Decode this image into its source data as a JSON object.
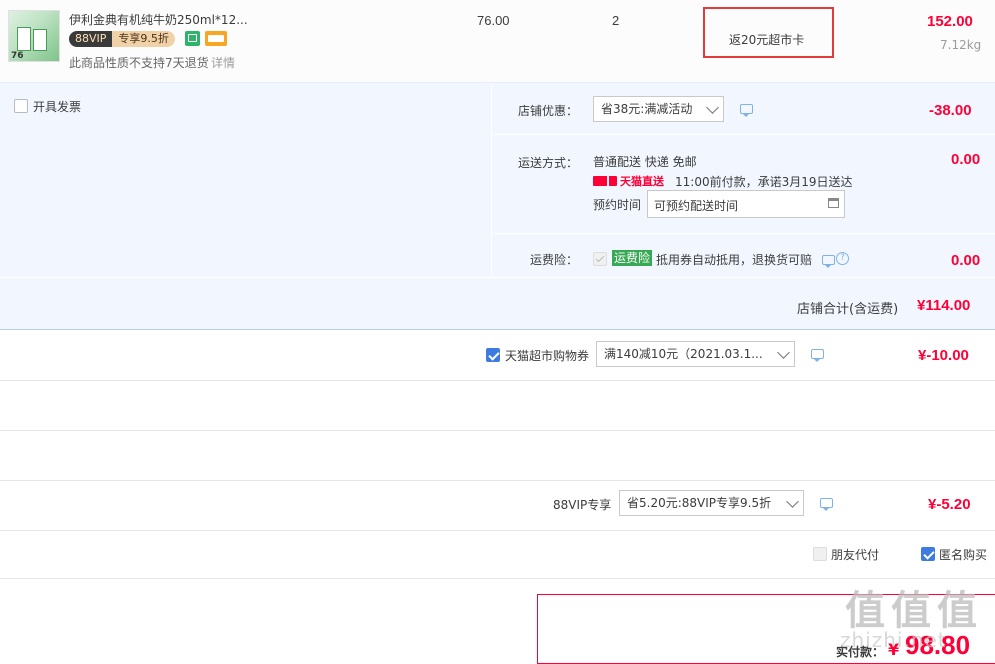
{
  "item": {
    "title": "伊利金典有机纯牛奶250ml*12...",
    "thumb_badge": "76",
    "vip_badge": "88VIP",
    "vip_discount": "专享9.5折",
    "no_return": "此商品性质不支持7天退货",
    "detail_link": "详情",
    "unit_price": "76.00",
    "quantity": "2",
    "promo": "返20元超市卡",
    "subtotal": "152.00",
    "weight": "7.12kg"
  },
  "invoice": {
    "label": "开具发票"
  },
  "shop_discount": {
    "label": "店铺优惠：",
    "select": "省38元:满减活动",
    "amount": "-38.00"
  },
  "shipping": {
    "label": "运送方式：",
    "method": "普通配送 快递 免邮",
    "tmall_express": "天猫直送",
    "promise": "11:00前付款，承诺3月19日送达",
    "appoint_label": "预约时间",
    "appoint_input": "可预约配送时间",
    "amount": "0.00"
  },
  "insurance": {
    "label": "运费险：",
    "badge": "运费险",
    "desc": "抵用券自动抵用，退换货可赔",
    "amount": "0.00"
  },
  "shop_total": {
    "label": "店铺合计(含运费)",
    "amount": "¥114.00"
  },
  "coupon": {
    "label": "天猫超市购物券",
    "select": "满140减10元（2021.03.1...",
    "amount": "¥-10.00"
  },
  "vip": {
    "label": "88VIP专享",
    "select": "省5.20元:88VIP专享9.5折",
    "amount": "¥-5.20"
  },
  "options": {
    "friend_pay": "朋友代付",
    "anonymous": "匿名购买"
  },
  "final": {
    "label": "实付款：",
    "currency": "¥",
    "amount": "98.80"
  },
  "watermark": {
    "logo_text": "值",
    "site": "zhizhi.net"
  },
  "colors": {
    "accent_red": "#ff0036",
    "panel_blue": "#f2f7ff",
    "check_blue": "#3d7be0"
  }
}
